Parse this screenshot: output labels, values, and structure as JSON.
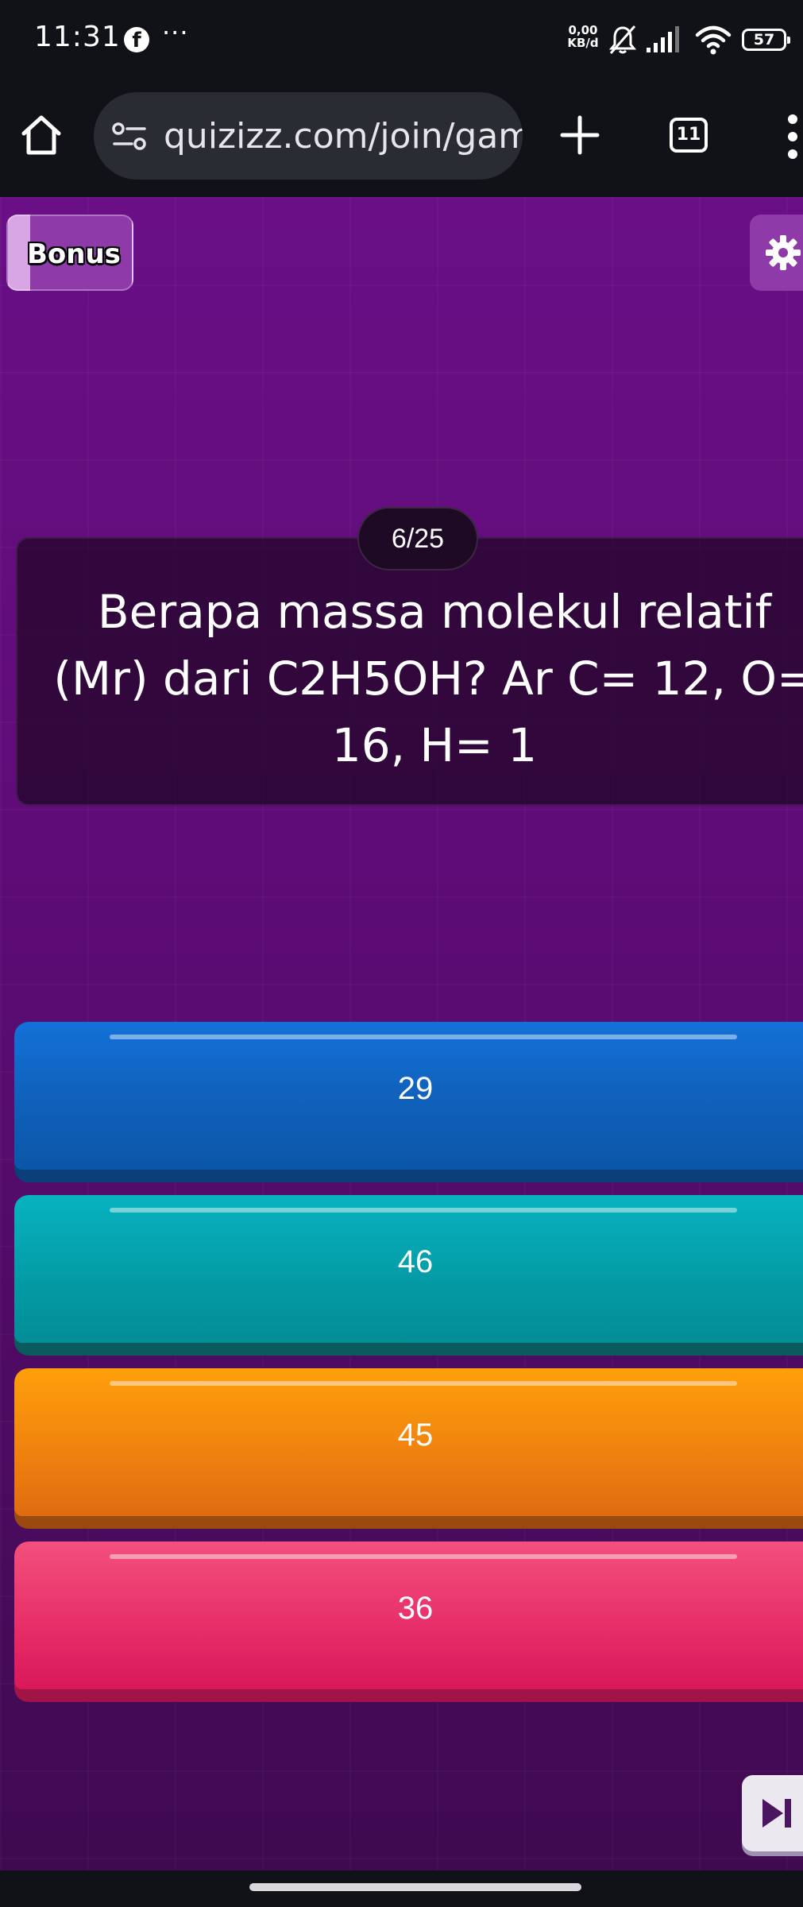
{
  "status_bar": {
    "time": "11:31",
    "more": "···",
    "net_speed_value": "0,00",
    "net_speed_unit": "KB/d",
    "battery": "57"
  },
  "browser": {
    "url": "quizizz.com/join/game",
    "tab_count": "11",
    "icons": [
      "home-icon",
      "site-info-icon",
      "plus-icon",
      "tabs-icon",
      "kebab-menu-icon"
    ]
  },
  "quiz": {
    "bonus_label": "Bonus",
    "counter": "6/25",
    "question": "Berapa massa molekul relatif (Mr) dari C2H5OH? Ar C= 12, O= 16, H= 1",
    "options": [
      {
        "label": "29",
        "color": "#1471d8"
      },
      {
        "label": "46",
        "color": "#07b3c0"
      },
      {
        "label": "45",
        "color": "#ff9f0a"
      },
      {
        "label": "36",
        "color": "#f2507e"
      }
    ],
    "background": "#5e0c77"
  }
}
